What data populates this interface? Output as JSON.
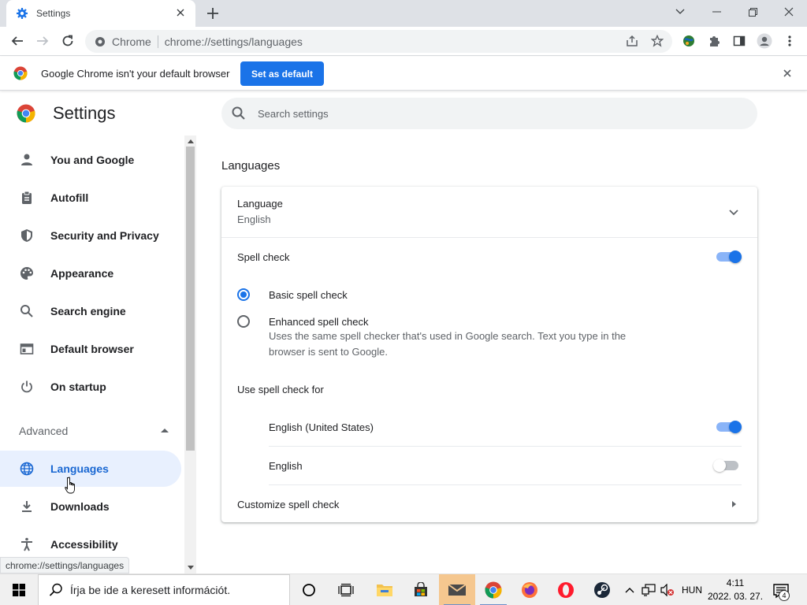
{
  "browser": {
    "tab_title": "Settings",
    "omnibox_site": "Chrome",
    "omnibox_url": "chrome://settings/languages"
  },
  "infobar": {
    "message": "Google Chrome isn't your default browser",
    "button": "Set as default"
  },
  "settings": {
    "title": "Settings",
    "search_placeholder": "Search settings"
  },
  "sidebar": {
    "items": [
      {
        "label": "You and Google",
        "icon": "person-icon"
      },
      {
        "label": "Autofill",
        "icon": "clipboard-icon"
      },
      {
        "label": "Security and Privacy",
        "icon": "shield-icon"
      },
      {
        "label": "Appearance",
        "icon": "palette-icon"
      },
      {
        "label": "Search engine",
        "icon": "search-icon"
      },
      {
        "label": "Default browser",
        "icon": "browser-window-icon"
      },
      {
        "label": "On startup",
        "icon": "power-icon"
      }
    ],
    "advanced_label": "Advanced",
    "advanced_items": [
      {
        "label": "Languages",
        "icon": "globe-icon",
        "active": true
      },
      {
        "label": "Downloads",
        "icon": "download-icon"
      },
      {
        "label": "Accessibility",
        "icon": "accessibility-icon"
      }
    ]
  },
  "main": {
    "section_title": "Languages",
    "language_row": {
      "label": "Language",
      "value": "English"
    },
    "spell_check": {
      "label": "Spell check",
      "enabled": true
    },
    "basic": {
      "label": "Basic spell check",
      "checked": true
    },
    "enhanced": {
      "label": "Enhanced spell check",
      "description": "Uses the same spell checker that's used in Google search. Text you type in the browser is sent to Google.",
      "checked": false
    },
    "use_for_label": "Use spell check for",
    "languages": [
      {
        "label": "English (United States)",
        "enabled": true
      },
      {
        "label": "English",
        "enabled": false
      }
    ],
    "customize_label": "Customize spell check"
  },
  "status_bubble": "chrome://settings/languages",
  "taskbar": {
    "search_placeholder": "Írja be ide a keresett információt.",
    "language": "HUN",
    "time": "4:11",
    "date": "2022. 03. 27.",
    "notification_count": "4"
  },
  "colors": {
    "accent": "#1a73e8",
    "active_nav_bg": "#e8f0fe"
  }
}
